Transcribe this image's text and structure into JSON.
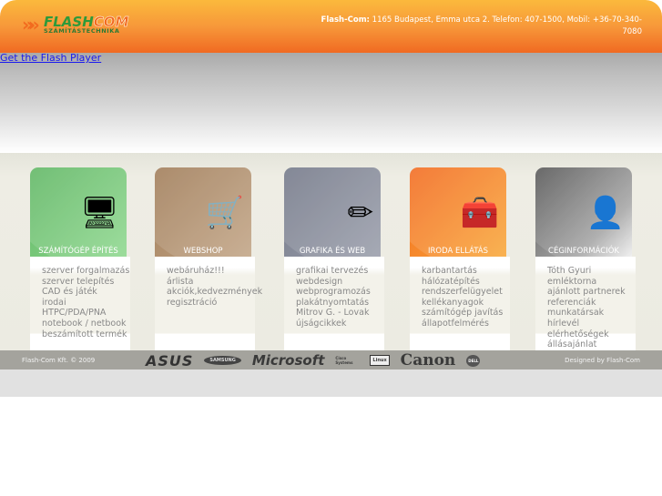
{
  "header": {
    "logo_text": "FLASHCOM",
    "logo_sub": "SZÁMÍTÁSTECHNIKA",
    "contact_company": "Flash-Com:",
    "contact_text": "1165 Budapest, Emma utca 2. Telefon: 407-1500, Mobil: +36-70-340-7080"
  },
  "flash_link": "Get the Flash Player",
  "cards": [
    {
      "title": "SZÁMÍTÓGÉP ÉPÍTÉS",
      "icon": "computer-icon",
      "color": "#6cc070",
      "items": [
        "szerver forgalmazás",
        "szerver telepítés",
        "CAD és játék",
        "irodai",
        "HTPC/PDA/PNA",
        "notebook / netbook",
        "beszámított termék"
      ]
    },
    {
      "title": "WEBSHOP",
      "icon": "shopping-cart-icon",
      "color": "#a98865",
      "items": [
        "webáruház!!!",
        "árlista",
        "akciók,kedvezmények",
        "regisztráció"
      ]
    },
    {
      "title": "GRAFIKA ÉS WEB",
      "icon": "contact-pencil-icon",
      "color": "#7e8394",
      "items": [
        "grafikai tervezés",
        "webdesign",
        "webprogramozás",
        "plakátnyomtatás",
        "Mitrov G. - Lovak",
        "újságcikkek"
      ]
    },
    {
      "title": "IRODA ELLÁTÁS",
      "icon": "toolbox-icon",
      "color": "#f07a2a",
      "items": [
        "karbantartás",
        "hálózatépítés",
        "rendszerfelügyelet",
        "kellékanyagok",
        "számítógép javítás",
        "állapotfelmérés"
      ]
    },
    {
      "title": "CÉGINFORMÁCIÓK",
      "icon": "person-info-icon",
      "color": "#6c6c6c",
      "items": [
        "Tóth Gyuri emléktorna",
        "ajánlott partnerek",
        "referenciák",
        "munkatársak",
        "hírlevél",
        "elérhetőségek",
        "állásajánlat"
      ]
    }
  ],
  "footer": {
    "copyright": "Flash-Com Kft. © 2009",
    "designed": "Designed by Flash-Com",
    "brands": [
      "ASUS",
      "SAMSUNG",
      "Microsoft",
      "Cisco Systems",
      "Linux",
      "Canon",
      "DELL"
    ]
  }
}
